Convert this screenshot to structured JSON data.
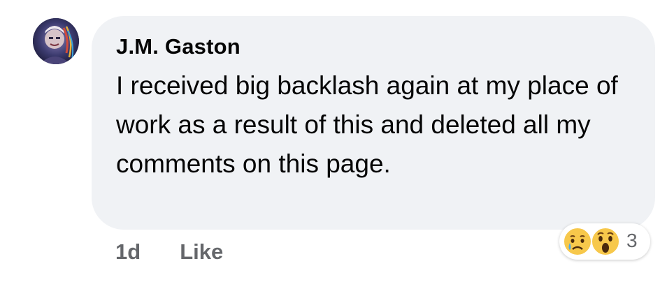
{
  "comment": {
    "author": "J.M. Gaston",
    "text": "I received big backlash again at my place of work as a result of this and deleted all my comments on this page.",
    "time": "1d",
    "like_label": "Like",
    "reactions": {
      "icons": [
        "sad-reaction-icon",
        "wow-reaction-icon"
      ],
      "count": "3"
    }
  },
  "colors": {
    "bubble": "#f0f2f5",
    "text": "#050505",
    "secondary": "#65676b",
    "reaction_yellow": "#f7c84b"
  }
}
